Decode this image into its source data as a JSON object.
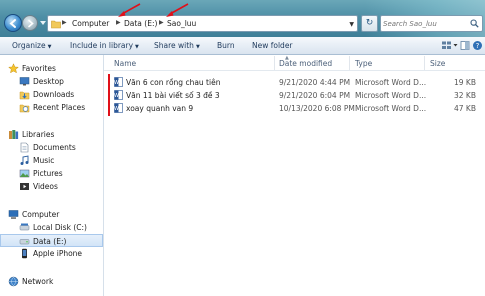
{
  "window": {
    "address": {
      "crumbs": [
        "Computer",
        "Data (E:)",
        "Sao_luu"
      ]
    },
    "search": {
      "placeholder": "Search Sao_luu"
    }
  },
  "toolbar": {
    "organize": "Organize",
    "include_in_library": "Include in library",
    "share_with": "Share with",
    "burn": "Burn",
    "new_folder": "New folder"
  },
  "sidebar": {
    "favorites": {
      "label": "Favorites",
      "items": [
        {
          "label": "Desktop",
          "icon": "desktop-icon"
        },
        {
          "label": "Downloads",
          "icon": "downloads-icon"
        },
        {
          "label": "Recent Places",
          "icon": "recent-places-icon"
        }
      ]
    },
    "libraries": {
      "label": "Libraries",
      "items": [
        {
          "label": "Documents",
          "icon": "documents-icon"
        },
        {
          "label": "Music",
          "icon": "music-icon"
        },
        {
          "label": "Pictures",
          "icon": "pictures-icon"
        },
        {
          "label": "Videos",
          "icon": "videos-icon"
        }
      ]
    },
    "computer": {
      "label": "Computer",
      "items": [
        {
          "label": "Local Disk (C:)",
          "icon": "hard-drive-icon"
        },
        {
          "label": "Data (E:)",
          "icon": "hard-drive-icon",
          "selected": true
        },
        {
          "label": "Apple iPhone",
          "icon": "phone-icon"
        }
      ]
    },
    "network": {
      "label": "Network"
    }
  },
  "columns": {
    "name": "Name",
    "date_modified": "Date modified",
    "type": "Type",
    "size": "Size"
  },
  "files": [
    {
      "name": "Văn 6 con rồng chau tiên",
      "date": "9/21/2020 4:44 PM",
      "type": "Microsoft Word D...",
      "size": "19 KB"
    },
    {
      "name": "Văn 11 bài viết số 3 đề 3",
      "date": "9/21/2020 6:04 PM",
      "type": "Microsoft Word D...",
      "size": "32 KB"
    },
    {
      "name": "xoay quanh van 9",
      "date": "10/13/2020 6:08 PM",
      "type": "Microsoft Word D...",
      "size": "47 KB"
    }
  ],
  "colors": {
    "titlebar": "#4e8fa6",
    "annotation_red": "#e0101a",
    "selection": "#d2e4f7"
  }
}
